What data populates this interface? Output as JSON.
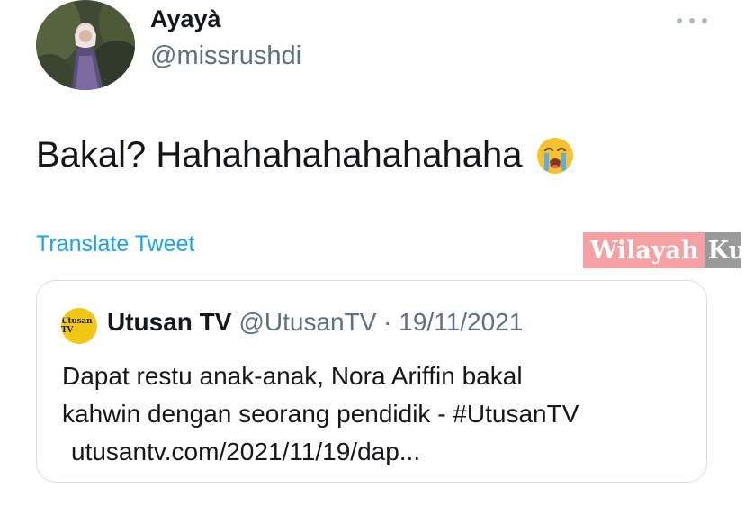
{
  "tweet": {
    "display_name": "Ayayà",
    "handle": "@missrushdi",
    "text": "Bakal? Hahahahahahahahaha",
    "emoji": "loudly-crying-face-emoji",
    "translate_label": "Translate Tweet"
  },
  "watermark": {
    "text_main": "Wilayah",
    "text_cut": "Ku"
  },
  "quoted_tweet": {
    "logo_text": "Utusan TV",
    "name": "Utusan TV",
    "meta": "@UtusanTV · 19/11/2021",
    "line1": "Dapat restu anak-anak, Nora Ariffin bakal",
    "line2": "kahwin dengan seorang pendidik - #UtusanTV",
    "link": "utusantv.com/2021/11/19/dap..."
  },
  "colors": {
    "link_blue": "#1da1f2",
    "secondary_text": "#5b7083",
    "card_border": "#d9dde1",
    "logo_yellow": "#f2c614"
  }
}
